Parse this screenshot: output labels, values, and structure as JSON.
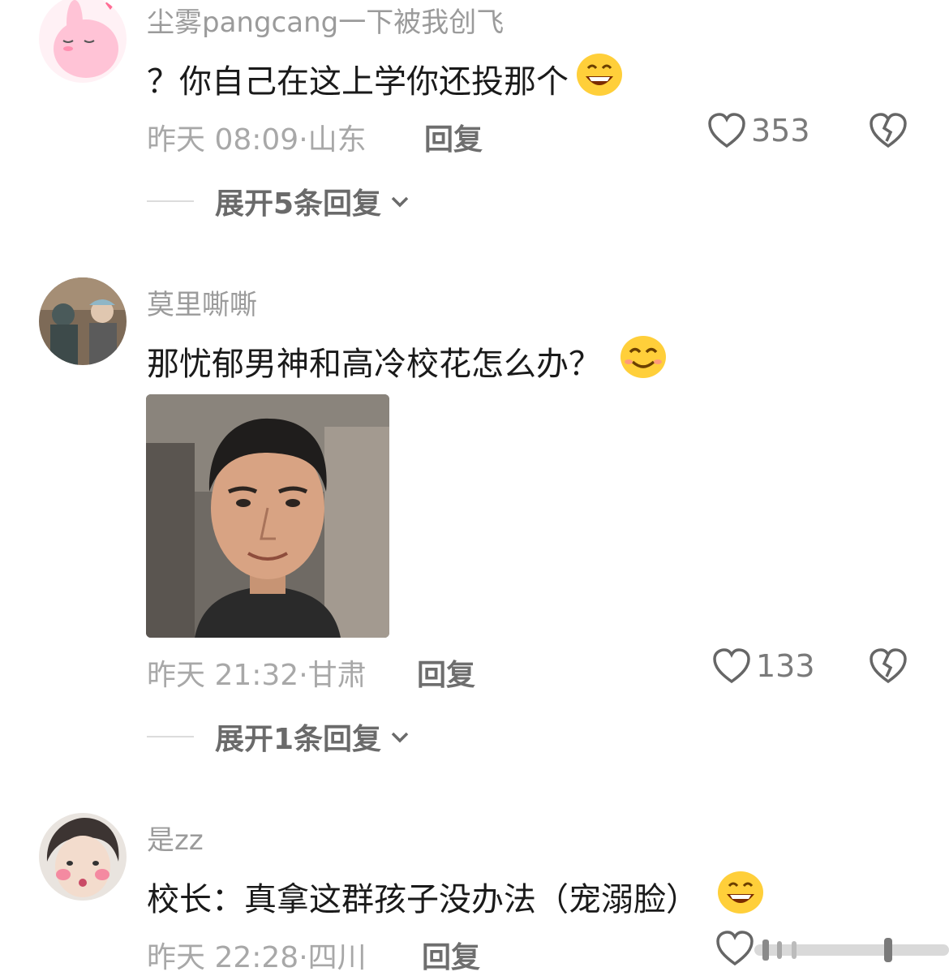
{
  "comments": [
    {
      "username": "尘雾pangcang一下被我创飞",
      "text": "？你自己在这上学你还投那个",
      "time": "昨天 08:09",
      "location": "山东",
      "reply_label": "回复",
      "likes": "353",
      "expand": "展开5条回复",
      "emoji": "grinning-emoji"
    },
    {
      "username": "莫里嘶嘶",
      "text": "那忧郁男神和高冷校花怎么办？",
      "time": "昨天 21:32",
      "location": "甘肃",
      "reply_label": "回复",
      "likes": "133",
      "expand": "展开1条回复",
      "emoji": "smiling-emoji"
    },
    {
      "username": "是zz",
      "text": "校长：真拿这群孩子没办法（宠溺脸）",
      "time": "昨天 22:28",
      "location": "四川",
      "reply_label": "回复",
      "emoji": "grinning-emoji"
    }
  ],
  "meta_separator": "·",
  "icons": {
    "like": "heart-outline-icon",
    "dislike": "broken-heart-icon",
    "expand": "chevron-down-icon"
  },
  "colors": {
    "meta": "#a8a8a8",
    "reply": "#6e6e6e",
    "text": "#1a1a1a"
  }
}
